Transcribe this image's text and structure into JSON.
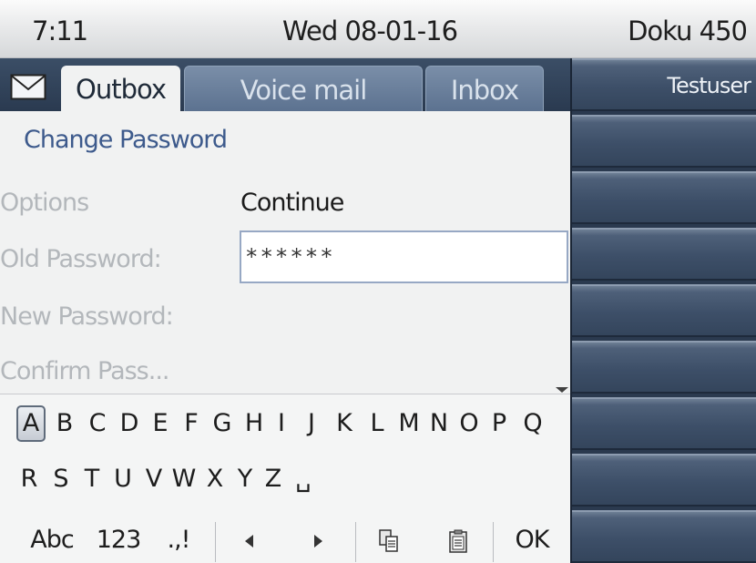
{
  "status_bar": {
    "time": "7:11",
    "date": "Wed 08-01-16",
    "device_name": "Doku 450"
  },
  "tabs": [
    {
      "label": "Outbox",
      "active": true
    },
    {
      "label": "Voice mail",
      "active": false
    },
    {
      "label": "Inbox",
      "active": false
    }
  ],
  "tab_icon": "envelope-icon",
  "right_panel": {
    "user_label": "Testuser",
    "key_count": 9
  },
  "form": {
    "title": "Change Password",
    "options_label": "Options",
    "options_value": "Continue",
    "old_password_label": "Old Password:",
    "old_password_value": "******",
    "new_password_label": "New Password:",
    "confirm_password_label": "Confirm Pass..."
  },
  "keyboard": {
    "selected_key": "A",
    "row1": [
      "A",
      "B",
      "C",
      "D",
      "E",
      "F",
      "G",
      "H",
      "I",
      "J",
      "K",
      "L",
      "M",
      "N",
      "O",
      "P",
      "Q"
    ],
    "row2": [
      "R",
      "S",
      "T",
      "U",
      "V",
      "W",
      "X",
      "Y",
      "Z",
      "␣"
    ]
  },
  "bottom_bar": {
    "abc_label": "Abc",
    "num_label": "123",
    "punct_label": ".,!",
    "left_icon": "cursor-left-icon",
    "right_icon": "cursor-right-icon",
    "copy_icon": "copy-icon",
    "paste_icon": "paste-icon",
    "ok_label": "OK"
  },
  "colors": {
    "accent_title": "#3d5a8c",
    "panel_dark": "#2b3a4f",
    "label_gray": "#b3b7bb"
  }
}
